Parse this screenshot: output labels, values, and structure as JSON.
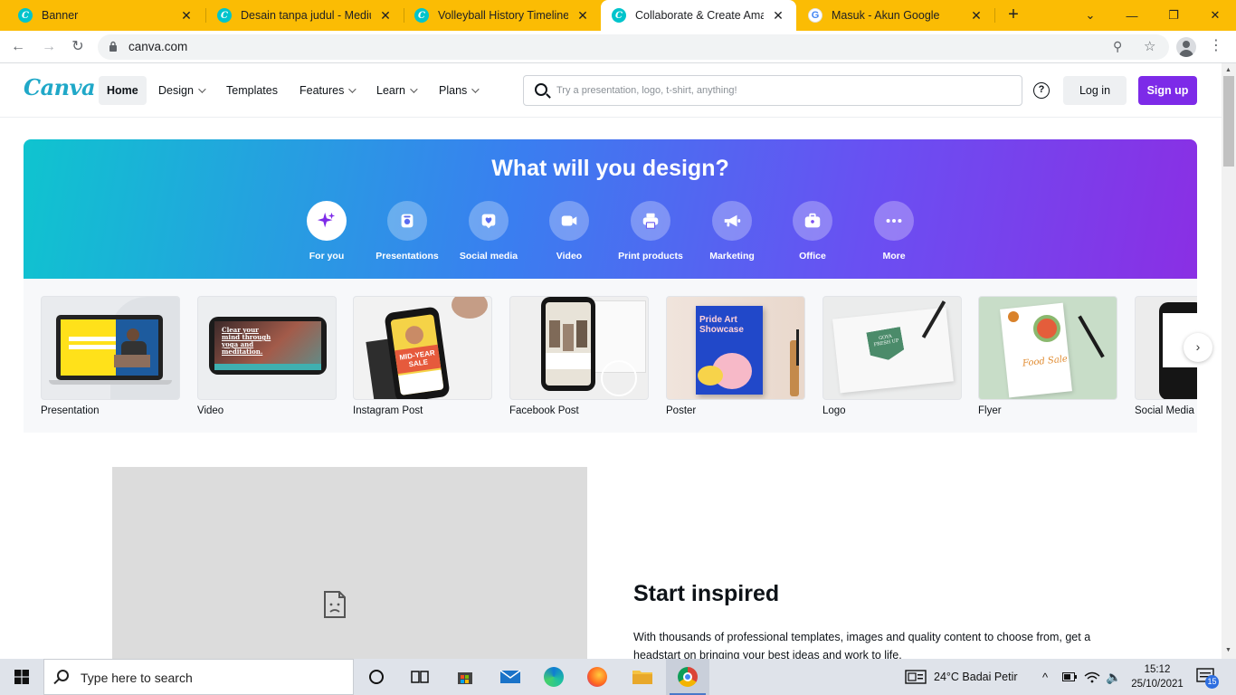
{
  "browser": {
    "tabs": [
      {
        "title": "Banner",
        "icon": "canva-icon",
        "active": false
      },
      {
        "title": "Desain tanpa judul - Medium",
        "icon": "canva-icon",
        "active": false
      },
      {
        "title": "Volleyball History Timeline In",
        "icon": "canva-icon",
        "active": false
      },
      {
        "title": "Collaborate & Create Amazin",
        "icon": "canva-icon",
        "active": true
      },
      {
        "title": "Masuk - Akun Google",
        "icon": "google-icon",
        "active": false
      }
    ],
    "url": "canva.com",
    "accent_color": "#fbbc04"
  },
  "nav": {
    "logo": "Canva",
    "items": [
      {
        "label": "Home",
        "dropdown": false
      },
      {
        "label": "Design",
        "dropdown": true
      },
      {
        "label": "Templates",
        "dropdown": false
      },
      {
        "label": "Features",
        "dropdown": true
      },
      {
        "label": "Learn",
        "dropdown": true
      },
      {
        "label": "Plans",
        "dropdown": true
      }
    ],
    "search_placeholder": "Try a presentation, logo, t-shirt, anything!",
    "help": "?",
    "login": "Log in",
    "signup": "Sign up",
    "brand_color": "#7d2ae8"
  },
  "hero": {
    "title": "What will you design?",
    "categories": [
      {
        "label": "For you",
        "icon": "sparkle-icon"
      },
      {
        "label": "Presentations",
        "icon": "presentation-icon"
      },
      {
        "label": "Social media",
        "icon": "heart-icon"
      },
      {
        "label": "Video",
        "icon": "video-camera-icon"
      },
      {
        "label": "Print products",
        "icon": "printer-icon"
      },
      {
        "label": "Marketing",
        "icon": "megaphone-icon"
      },
      {
        "label": "Office",
        "icon": "briefcase-icon"
      },
      {
        "label": "More",
        "icon": "more-dots-icon"
      }
    ]
  },
  "templates": [
    {
      "label": "Presentation"
    },
    {
      "label": "Video"
    },
    {
      "label": "Instagram Post"
    },
    {
      "label": "Facebook Post"
    },
    {
      "label": "Poster"
    },
    {
      "label": "Logo"
    },
    {
      "label": "Flyer"
    },
    {
      "label": "Social Media"
    }
  ],
  "thumb_text": {
    "video": "Clear your mind through yoga and meditation.",
    "instagram": "MID-YEAR SALE",
    "poster": "Pride Art Showcase",
    "logo": "GOYA FRESH UP",
    "flyer": "Food Sale"
  },
  "inspired": {
    "title": "Start inspired",
    "text": "With thousands of professional templates, images and quality content to choose from, get a headstart on bringing your best ideas and work to life."
  },
  "taskbar": {
    "search_text": "Type here to search",
    "weather": "24°C  Badai Petir",
    "time": "15:12",
    "date": "25/10/2021",
    "notifications": "15"
  }
}
